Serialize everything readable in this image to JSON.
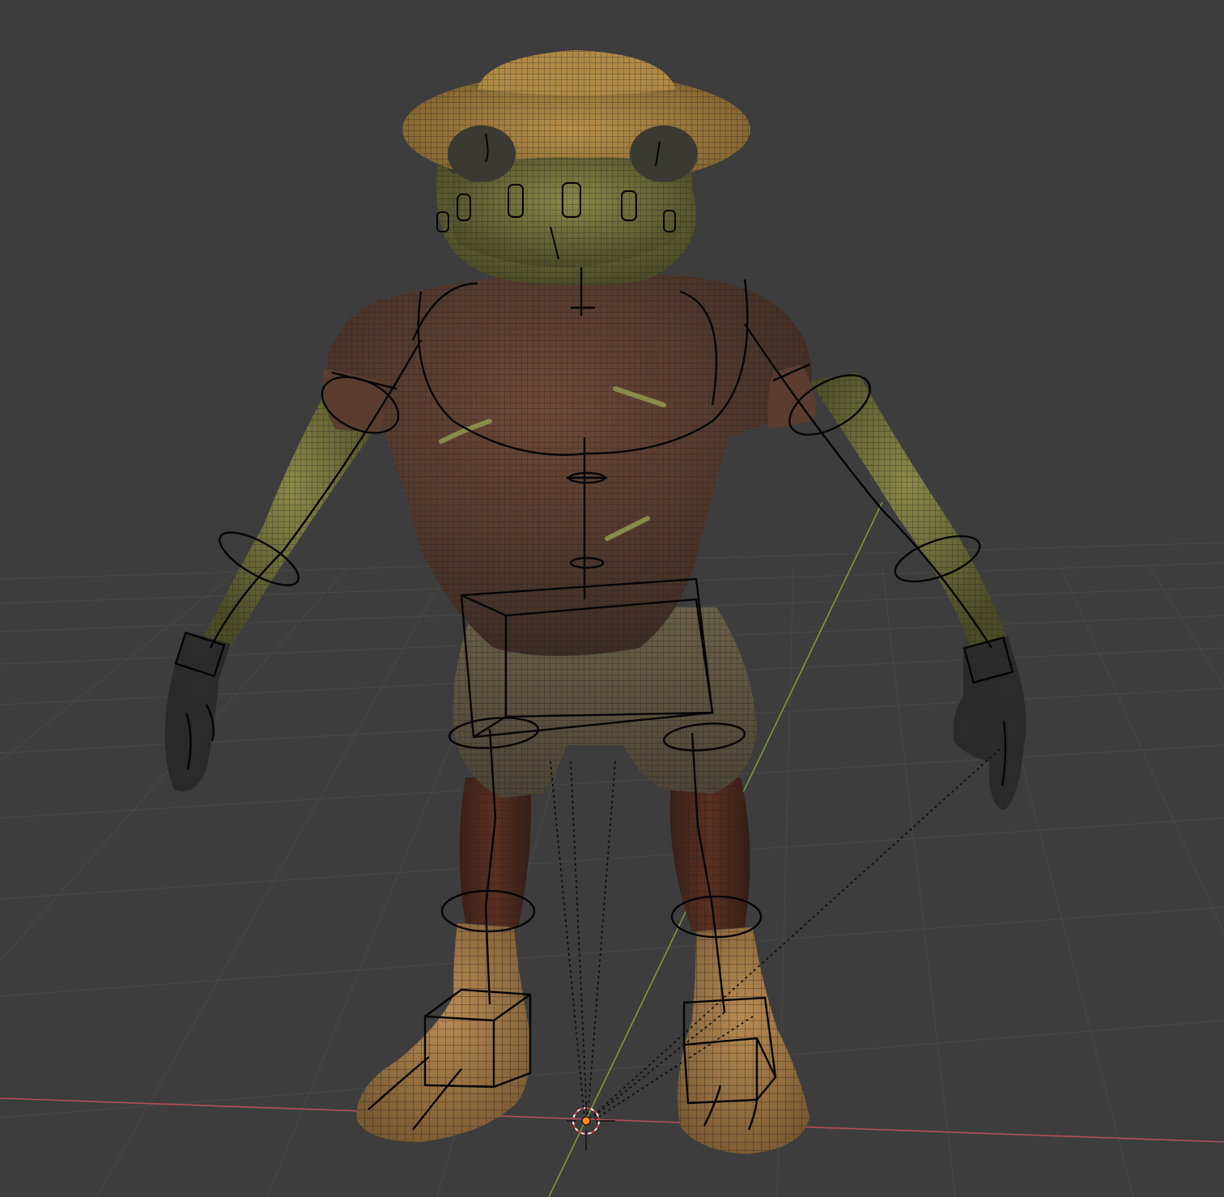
{
  "viewport": {
    "background": "#3d3d3d",
    "grid_color": "#474747",
    "x_axis_color": "#b4505a",
    "y_axis_color": "#7a9a3c",
    "origin_color": "#ff8a1e"
  },
  "scene": {
    "character": {
      "skin_color": "#6d6d3a",
      "shirt_color": "#5a3d2e",
      "shorts_color": "#5d5540",
      "boots_color": "#a27a47",
      "hat_color": "#a4803f",
      "gloves_color": "#2b2b2b",
      "wire_color": "#1d1d1d"
    },
    "rig": {
      "line_color": "#050505"
    }
  },
  "icons": {
    "origin": "object-origin-icon",
    "cursor": "3d-cursor-icon"
  }
}
